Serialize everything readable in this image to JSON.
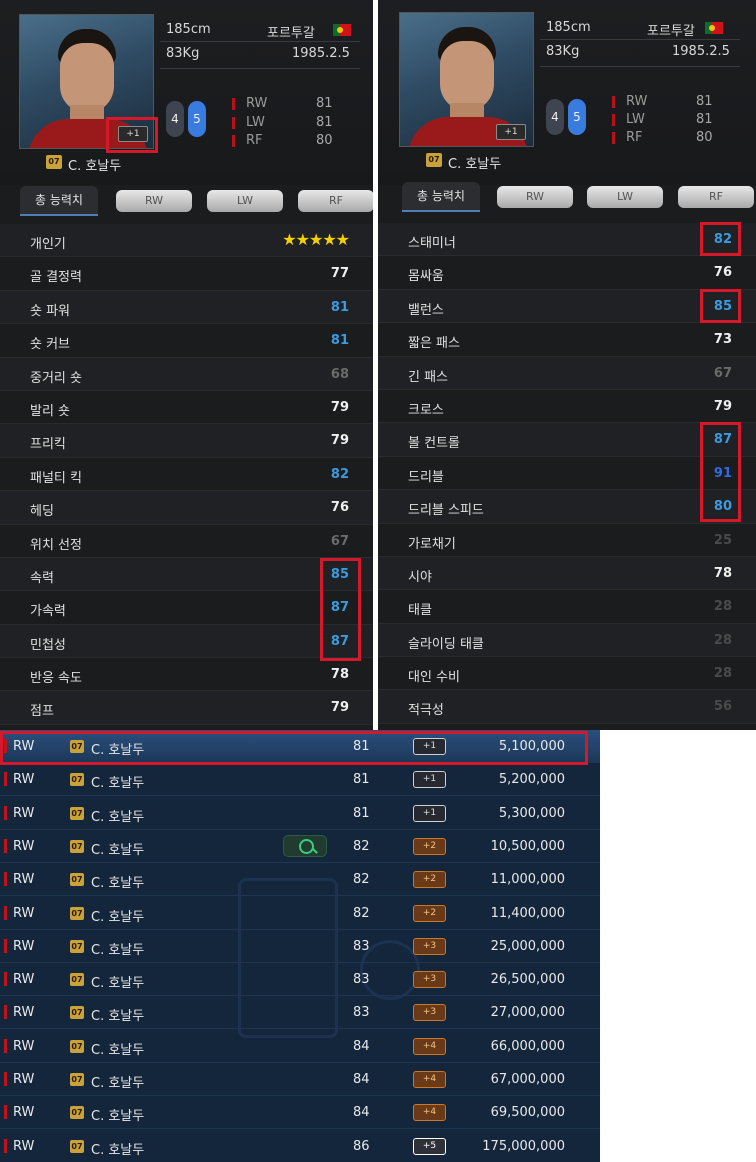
{
  "player": {
    "name": "C. 호날두",
    "season": "07",
    "height": "185cm",
    "weight": "83Kg",
    "nation": "포르투갈",
    "birth": "1985.2.5",
    "enhance": "+1",
    "weak_foot": "4",
    "strong_foot": "5",
    "positions": [
      {
        "pos": "RW",
        "ovr": "81"
      },
      {
        "pos": "LW",
        "ovr": "81"
      },
      {
        "pos": "RF",
        "ovr": "80"
      }
    ]
  },
  "tabs": [
    "총 능력치",
    "RW",
    "LW",
    "RF"
  ],
  "stars": "★★★★★",
  "left_stats": [
    {
      "label": "개인기",
      "value": "",
      "color": "#f0f0f0"
    },
    {
      "label": "골 결정력",
      "value": "77",
      "color": "#f0f0f0"
    },
    {
      "label": "숏 파워",
      "value": "81",
      "color": "#3b9be0"
    },
    {
      "label": "숏 커브",
      "value": "81",
      "color": "#3b9be0"
    },
    {
      "label": "중거리 숏",
      "value": "68",
      "color": "#6b6b6b"
    },
    {
      "label": "발리 숏",
      "value": "79",
      "color": "#f0f0f0"
    },
    {
      "label": "프리킥",
      "value": "79",
      "color": "#f0f0f0"
    },
    {
      "label": "패널티 킥",
      "value": "82",
      "color": "#3b9be0"
    },
    {
      "label": "헤딩",
      "value": "76",
      "color": "#f0f0f0"
    },
    {
      "label": "위치 선정",
      "value": "67",
      "color": "#6b6b6b"
    },
    {
      "label": "속력",
      "value": "85",
      "color": "#3b9be0"
    },
    {
      "label": "가속력",
      "value": "87",
      "color": "#3b9be0"
    },
    {
      "label": "민첩성",
      "value": "87",
      "color": "#3b9be0"
    },
    {
      "label": "반응 속도",
      "value": "78",
      "color": "#f0f0f0"
    },
    {
      "label": "점프",
      "value": "79",
      "color": "#f0f0f0"
    }
  ],
  "right_stats": [
    {
      "label": "스태미너",
      "value": "82",
      "color": "#3b9be0"
    },
    {
      "label": "몸싸움",
      "value": "76",
      "color": "#f0f0f0"
    },
    {
      "label": "밸런스",
      "value": "85",
      "color": "#3b9be0"
    },
    {
      "label": "짧은 패스",
      "value": "73",
      "color": "#f0f0f0"
    },
    {
      "label": "긴 패스",
      "value": "67",
      "color": "#6b6b6b"
    },
    {
      "label": "크로스",
      "value": "79",
      "color": "#f0f0f0"
    },
    {
      "label": "볼 컨트롤",
      "value": "87",
      "color": "#3b9be0"
    },
    {
      "label": "드리블",
      "value": "91",
      "color": "#2f6be0"
    },
    {
      "label": "드리블 스피드",
      "value": "80",
      "color": "#3b9be0"
    },
    {
      "label": "가로채기",
      "value": "25",
      "color": "#4a4a4a"
    },
    {
      "label": "시야",
      "value": "78",
      "color": "#f0f0f0"
    },
    {
      "label": "태클",
      "value": "28",
      "color": "#4a4a4a"
    },
    {
      "label": "슬라이딩 태클",
      "value": "28",
      "color": "#4a4a4a"
    },
    {
      "label": "대인 수비",
      "value": "28",
      "color": "#4a4a4a"
    },
    {
      "label": "적극성",
      "value": "56",
      "color": "#4a4a4a"
    }
  ],
  "market": [
    {
      "pos": "RW",
      "season": "07",
      "name": "C. 호날두",
      "ovr": "81",
      "grade": "+1",
      "price": "5,100,000"
    },
    {
      "pos": "RW",
      "season": "07",
      "name": "C. 호날두",
      "ovr": "81",
      "grade": "+1",
      "price": "5,200,000"
    },
    {
      "pos": "RW",
      "season": "07",
      "name": "C. 호날두",
      "ovr": "81",
      "grade": "+1",
      "price": "5,300,000"
    },
    {
      "pos": "RW",
      "season": "07",
      "name": "C. 호날두",
      "ovr": "82",
      "grade": "+2",
      "price": "10,500,000"
    },
    {
      "pos": "RW",
      "season": "07",
      "name": "C. 호날두",
      "ovr": "82",
      "grade": "+2",
      "price": "11,000,000"
    },
    {
      "pos": "RW",
      "season": "07",
      "name": "C. 호날두",
      "ovr": "82",
      "grade": "+2",
      "price": "11,400,000"
    },
    {
      "pos": "RW",
      "season": "07",
      "name": "C. 호날두",
      "ovr": "83",
      "grade": "+3",
      "price": "25,000,000"
    },
    {
      "pos": "RW",
      "season": "07",
      "name": "C. 호날두",
      "ovr": "83",
      "grade": "+3",
      "price": "26,500,000"
    },
    {
      "pos": "RW",
      "season": "07",
      "name": "C. 호날두",
      "ovr": "83",
      "grade": "+3",
      "price": "27,000,000"
    },
    {
      "pos": "RW",
      "season": "07",
      "name": "C. 호날두",
      "ovr": "84",
      "grade": "+4",
      "price": "66,000,000"
    },
    {
      "pos": "RW",
      "season": "07",
      "name": "C. 호날두",
      "ovr": "84",
      "grade": "+4",
      "price": "67,000,000"
    },
    {
      "pos": "RW",
      "season": "07",
      "name": "C. 호날두",
      "ovr": "84",
      "grade": "+4",
      "price": "69,500,000"
    },
    {
      "pos": "RW",
      "season": "07",
      "name": "C. 호날두",
      "ovr": "86",
      "grade": "+5",
      "price": "175,000,000"
    }
  ],
  "colors": {
    "highlight": "#d41a2a",
    "good": "#3b9be0",
    "poor": "#6b6b6b"
  }
}
